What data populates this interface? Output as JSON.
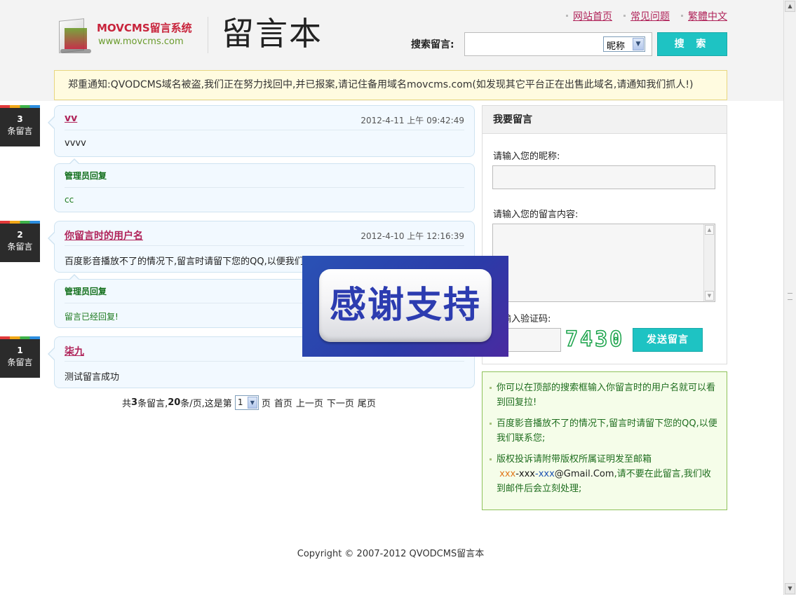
{
  "header": {
    "logo_name": "MOVCMS留言系统",
    "logo_url": "www.movcms.com",
    "title": "留言本",
    "links": [
      "网站首页",
      "常见问题",
      "繁體中文"
    ],
    "search_label": "搜索留言:",
    "search_value": "",
    "search_type": "昵称",
    "search_button": "搜 索"
  },
  "notice": "郑重通知:QVODCMS域名被盗,我们正在努力找回中,并已报案,请记住备用域名movcms.com(如发现其它平台正在出售此域名,请通知我们抓人!)",
  "messages": [
    {
      "count": "3",
      "count_label": "条留言",
      "name": "vv",
      "time": "2012-4-11 上午 09:42:49",
      "content": "vvvv",
      "reply_title": "管理员回复",
      "reply": "cc"
    },
    {
      "count": "2",
      "count_label": "条留言",
      "name": "你留言时的用户名",
      "time": "2012-4-10 上午 12:16:39",
      "content": "百度影音播放不了的情况下,留言时请留下您的QQ,以便我们联系您",
      "reply_title": "管理员回复",
      "reply": "留言已经回复!"
    },
    {
      "count": "1",
      "count_label": "条留言",
      "name": "柒九",
      "content": "测试留言成功"
    }
  ],
  "pager": {
    "prefix": "共",
    "total": "3",
    "mid1": "条留言,",
    "per_page": "20",
    "mid2": "条/页,这是第",
    "page": "1",
    "suffix": "页",
    "first": "首页",
    "prev": "上一页",
    "next": "下一页",
    "last": "尾页"
  },
  "form": {
    "heading": "我要留言",
    "nick_label": "请输入您的昵称:",
    "nick_value": "",
    "content_label": "请输入您的留言内容:",
    "content_value": "",
    "captcha_label": "请输入验证码:",
    "captcha_code": "7430",
    "submit": "发送留言"
  },
  "tips": {
    "tip1": "你可以在顶部的搜索框输入你留言时的用户名就可以看到回复拉!",
    "tip2": "百度影音播放不了的情况下,留言时请留下您的QQ,以便我们联系您;",
    "tip3_prefix": "版权投诉请附带版权所属证明发至邮箱",
    "email_p1": "xxx",
    "email_p2": "-xxx",
    "email_p3": "-xxx",
    "email_p4": "@Gmail.Com",
    "tip3_suffix": ",请不要在此留言,我们收到邮件后会立刻处理;"
  },
  "popup_text": "感谢支持",
  "copyright": "Copyright © 2007-2012 QVODCMS留言本",
  "colors": {
    "accent": "#1ec3c3",
    "link": "#b0245a",
    "reply": "#14701d",
    "notice_bg": "#fffbe0",
    "tips_border": "#8ec25a"
  }
}
